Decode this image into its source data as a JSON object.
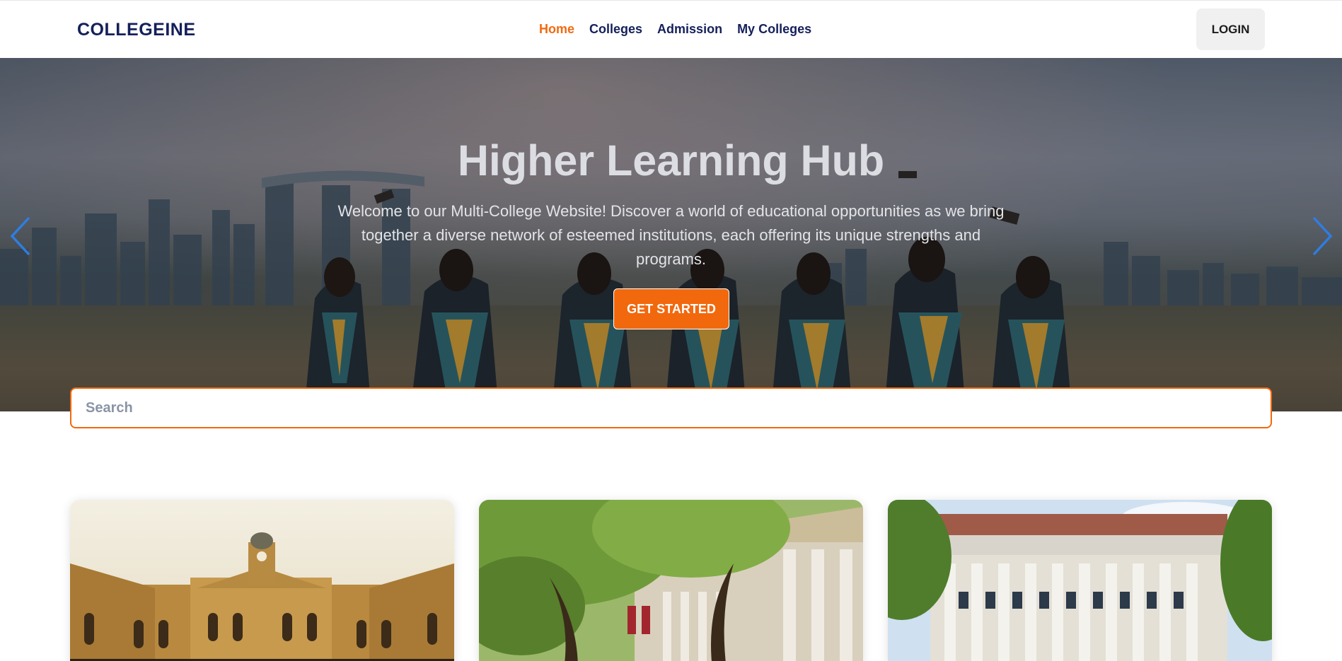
{
  "nav": {
    "brand": "COLLEGEINE",
    "links": [
      {
        "label": "Home",
        "active": true
      },
      {
        "label": "Colleges",
        "active": false
      },
      {
        "label": "Admission",
        "active": false
      },
      {
        "label": "My Colleges",
        "active": false
      }
    ],
    "login_label": "LOGIN"
  },
  "hero": {
    "title": "Higher Learning Hub",
    "text": "Welcome to our Multi-College Website! Discover a world of educational opportunities as we bring together a diverse network of esteemed institutions, each offering its unique strengths and programs.",
    "cta_label": "GET STARTED",
    "prev_icon": "chevron-left-icon",
    "next_icon": "chevron-right-icon"
  },
  "search": {
    "placeholder": "Search",
    "value": ""
  },
  "colors": {
    "accent": "#f2680d",
    "brand": "#14205a",
    "arrow": "#2f7de1"
  }
}
